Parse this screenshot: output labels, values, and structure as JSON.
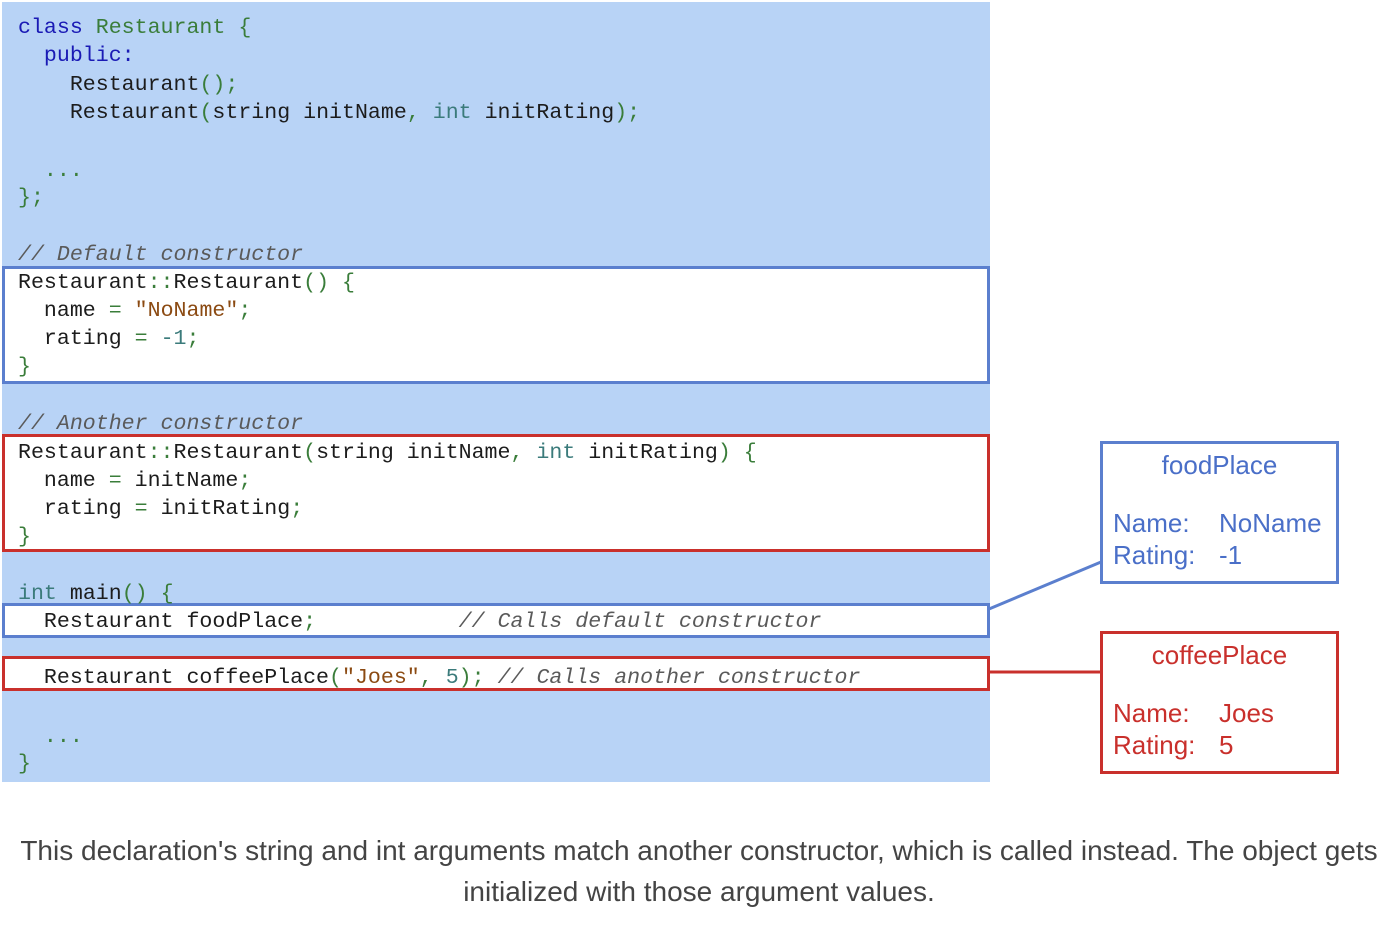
{
  "code": {
    "class_decl": {
      "kw": "class",
      "name": "Restaurant",
      "brace": "{"
    },
    "public_label": "public:",
    "ctor_default_decl": {
      "name": "Restaurant",
      "args": "();"
    },
    "ctor_param_decl": {
      "name": "Restaurant",
      "open": "(",
      "t1": "string",
      "p1": " initName",
      "comma": ",",
      "t2": "int",
      "p2": " initRating",
      "close": ");"
    },
    "ellipsis": "...",
    "class_end": "};",
    "comment_default": "// Default constructor",
    "default_def": {
      "header": {
        "name": "Restaurant",
        "sep": "::",
        "name2": "Restaurant",
        "args": "()",
        "brace": "{"
      },
      "line1": {
        "lhs": "name",
        "op": "=",
        "str": "\"NoName\"",
        "end": ";"
      },
      "line2": {
        "lhs": "rating",
        "op": "=",
        "val": "-1",
        "end": ";"
      },
      "close": "}"
    },
    "comment_another": "// Another constructor",
    "another_def": {
      "header": {
        "name": "Restaurant",
        "sep": "::",
        "name2": "Restaurant",
        "open": "(",
        "t1": "string",
        "p1": " initName",
        "comma": ",",
        "t2": "int",
        "p2": " initRating",
        "close": ")",
        "brace": "{"
      },
      "line1": {
        "lhs": "name",
        "op": "=",
        "rhs": "initName",
        "end": ";"
      },
      "line2": {
        "lhs": "rating",
        "op": "=",
        "rhs": "initRating",
        "end": ";"
      },
      "close": "}"
    },
    "main_decl": {
      "kw": "int",
      "name": "main",
      "args": "()",
      "brace": "{"
    },
    "food_line": {
      "type": "Restaurant",
      "var": " foodPlace",
      "end": ";",
      "comment": "// Calls default constructor"
    },
    "coffee_line": {
      "type": "Restaurant",
      "var": " coffeePlace",
      "open": "(",
      "str": "\"Joes\"",
      "comma": ",",
      "num": "5",
      "close": ");",
      "comment": "// Calls another constructor"
    },
    "main_ellipsis": "...",
    "main_close": "}"
  },
  "objects": {
    "food": {
      "title": "foodPlace",
      "name_label": "Name:",
      "name_value": "NoName",
      "rating_label": "Rating:",
      "rating_value": "-1"
    },
    "coffee": {
      "title": "coffeePlace",
      "name_label": "Name:",
      "name_value": "Joes",
      "rating_label": "Rating:",
      "rating_value": "5"
    }
  },
  "caption": "This declaration's string and int arguments match another constructor, which is called instead. The object gets initialized with those argument values.",
  "colors": {
    "panel": "#b8d3f6",
    "blue_frame": "#5b7fce",
    "red_frame": "#c9302c"
  }
}
